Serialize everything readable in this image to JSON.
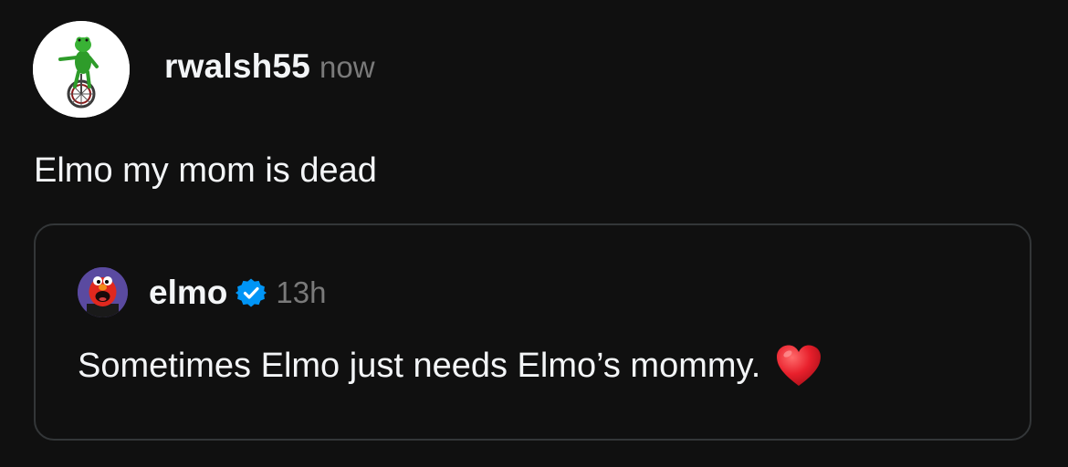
{
  "post": {
    "username": "rwalsh55",
    "timestamp": "now",
    "text": "Elmo my mom is dead",
    "avatar_icon": "frog-on-unicycle-avatar"
  },
  "quote": {
    "username": "elmo",
    "verified": true,
    "verified_icon": "verified-badge-icon",
    "timestamp": "13h",
    "text": "Sometimes Elmo just needs Elmo’s mommy.",
    "emoji": "red-heart-icon",
    "avatar_icon": "elmo-avatar"
  },
  "colors": {
    "background": "#101010",
    "text": "#f3f5f7",
    "muted": "#7a7a7a",
    "card_border": "#333638",
    "verified_blue": "#0095f6",
    "heart_red": "#e8202c"
  }
}
